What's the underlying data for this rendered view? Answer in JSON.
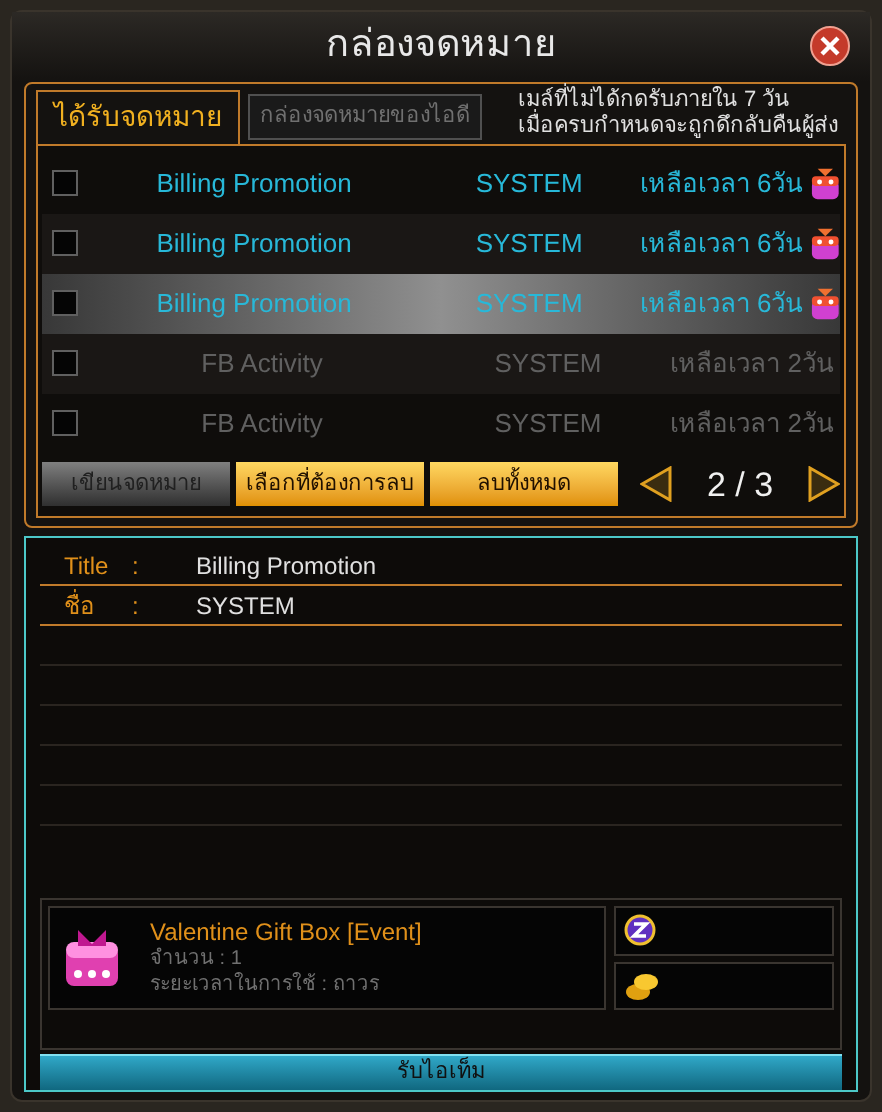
{
  "window": {
    "title": "กล่องจดหมาย"
  },
  "tabs": [
    {
      "label": "ได้รับจดหมาย",
      "selected": true
    },
    {
      "label": "กล่องจดหมายของไอดี",
      "selected": false
    }
  ],
  "notice": "เมล์ที่ไม่ได้กดรับภายใน 7 วัน\nเมื่อครบกำหนดจะถูกดึกลับคืนผู้ส่ง",
  "mails": [
    {
      "title": "Billing Promotion",
      "sender": "SYSTEM",
      "remaining": "เหลือเวลา 6วัน",
      "checked": false,
      "read": false,
      "has_gift": true,
      "selected": false
    },
    {
      "title": "Billing Promotion",
      "sender": "SYSTEM",
      "remaining": "เหลือเวลา 6วัน",
      "checked": false,
      "read": false,
      "has_gift": true,
      "selected": false
    },
    {
      "title": "Billing Promotion",
      "sender": "SYSTEM",
      "remaining": "เหลือเวลา 6วัน",
      "checked": false,
      "read": false,
      "has_gift": true,
      "selected": true
    },
    {
      "title": "FB Activity",
      "sender": "SYSTEM",
      "remaining": "เหลือเวลา 2วัน",
      "checked": false,
      "read": true,
      "has_gift": false,
      "selected": false
    },
    {
      "title": "FB Activity",
      "sender": "SYSTEM",
      "remaining": "เหลือเวลา 2วัน",
      "checked": false,
      "read": true,
      "has_gift": false,
      "selected": false
    }
  ],
  "buttons": [
    {
      "label": "เขียนจดหมาย",
      "disabled": true
    },
    {
      "label": "เลือกที่ต้องการลบ",
      "disabled": false
    },
    {
      "label": "ลบทั้งหมด",
      "disabled": false
    }
  ],
  "page": "2 / 3",
  "detail": {
    "fields": [
      {
        "label": "Title",
        "separator": ":",
        "value": "Billing Promotion"
      },
      {
        "label": "ชื่อ",
        "separator": ":",
        "value": "SYSTEM"
      }
    ],
    "item": {
      "name": "Valentine Gift Box [Event]",
      "quantity": "จำนวน : 1",
      "duration": "ระยะเวลาในการใช้ : ถาวร"
    },
    "receive_button": "รับไอเท็ม"
  }
}
